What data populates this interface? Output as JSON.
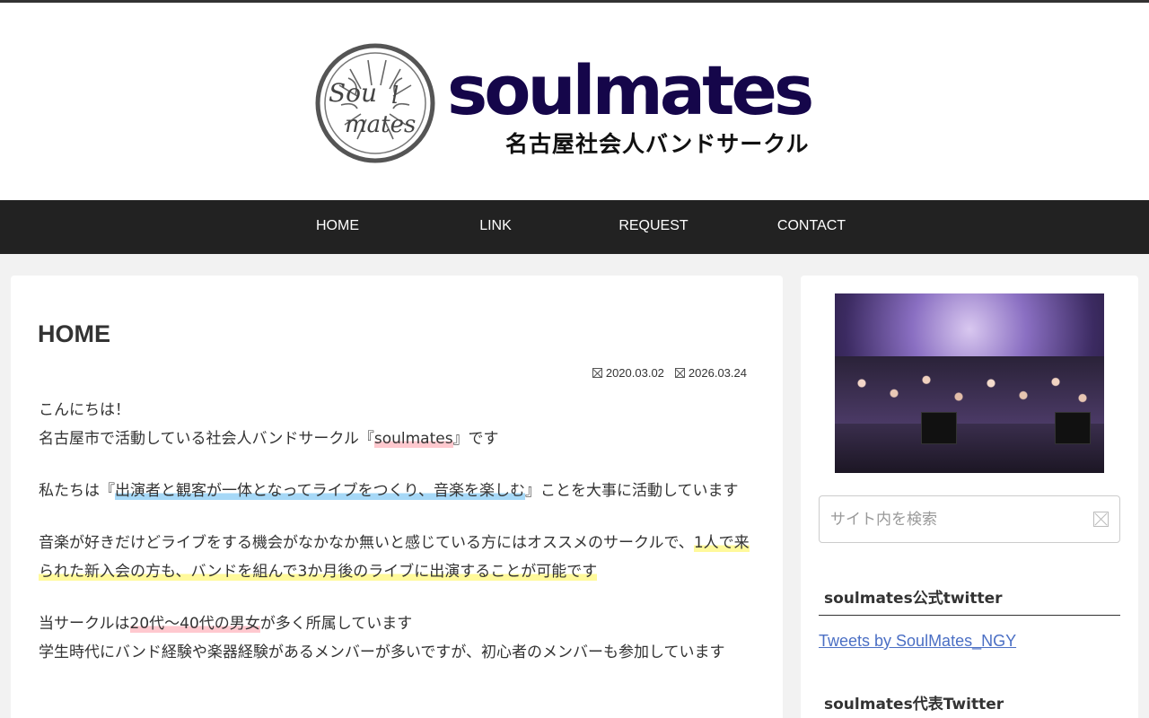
{
  "header": {
    "logo_word": "soulmates",
    "logo_subtitle": "名古屋社会人バンドサークル",
    "logo_color": "#15064a"
  },
  "nav": {
    "items": [
      {
        "label": "HOME"
      },
      {
        "label": "LINK"
      },
      {
        "label": "REQUEST"
      },
      {
        "label": "CONTACT"
      }
    ]
  },
  "main": {
    "title": "HOME",
    "published_date": "2020.03.02",
    "updated_date": "2026.03.24",
    "paragraphs": {
      "p1_line1": "こんにちは！",
      "p1_line2_pre": "名古屋市で活動している社会人バンドサークル『",
      "p1_line2_hl": "soulmates",
      "p1_line2_post": "』です",
      "p2_pre": "私たちは『",
      "p2_hl": "出演者と観客が一体となってライブをつくり、音楽を楽しむ",
      "p2_post": "』ことを大事に活動しています",
      "p3_pre": "音楽が好きだけどライブをする機会がなかなか無いと感じている方にはオススメのサークルで、",
      "p3_hl": "1人で来られた新入会の方も、バンドを組んで3か月後のライブに出演することが可能です",
      "p4_line1_pre": "当サークルは",
      "p4_line1_hl": "20代～40代の男女",
      "p4_line1_post": "が多く所属しています",
      "p4_line2": "学生時代にバンド経験や楽器経験があるメンバーが多いですが、初心者のメンバーも参加しています"
    }
  },
  "sidebar": {
    "search_placeholder": "サイト内を検索",
    "widget1_title": "soulmates公式twitter",
    "twitter_link": "Tweets by SoulMates_NGY",
    "widget2_title": "soulmates代表Twitter"
  },
  "colors": {
    "nav_bg": "#222222",
    "highlight_red": "#ffc9cf",
    "highlight_blue": "#a6d8f7",
    "highlight_yellow": "#fff99b",
    "link": "#4b6fc4"
  },
  "icons": {
    "date_icons": "broken-glyph-icon",
    "search": "search-icon"
  }
}
